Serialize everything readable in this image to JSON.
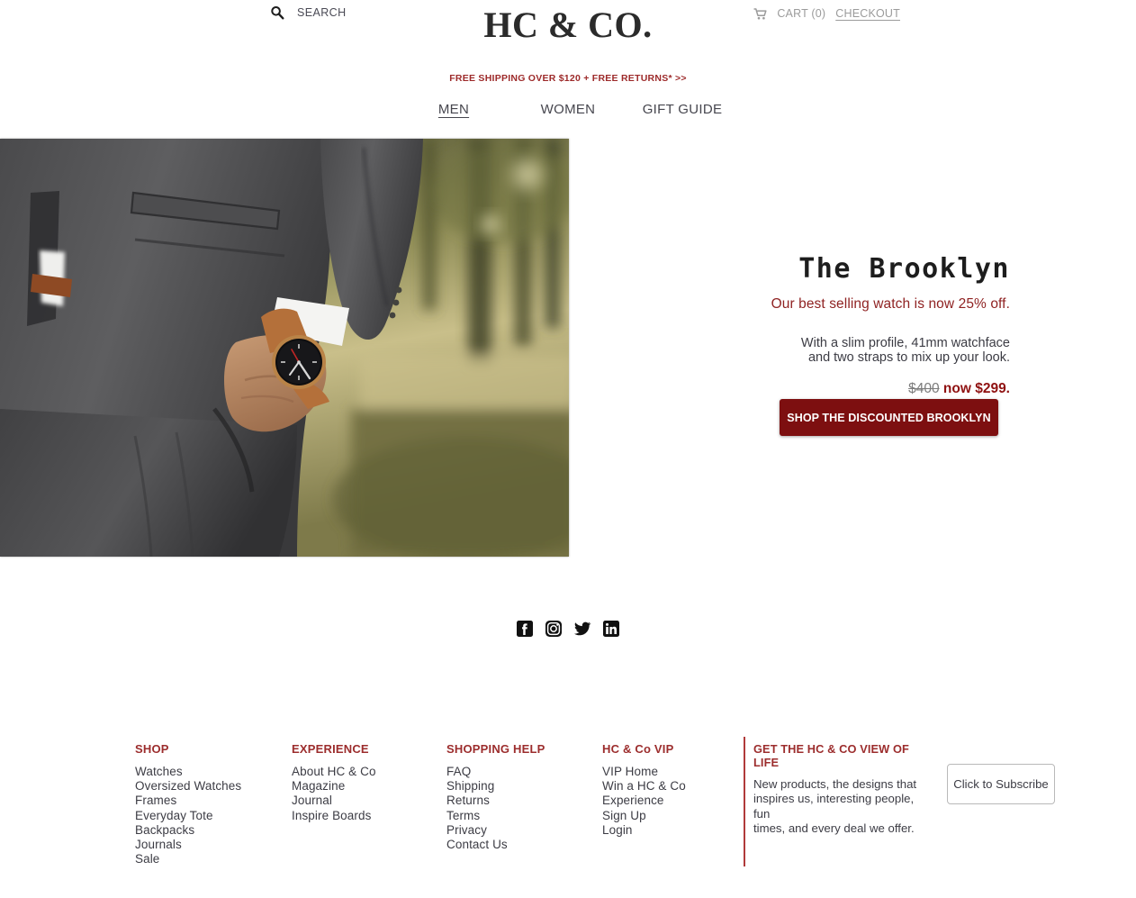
{
  "header": {
    "search_icon": "search-icon",
    "search_label": "SEARCH",
    "logo": "HC & CO.",
    "cart_icon": "shopping-cart-icon",
    "cart_label": "CART (0)",
    "checkout_label": "CHECKOUT"
  },
  "promo": {
    "text": "FREE SHIPPING OVER $120  +  FREE RETURNS* >>",
    "color": "#9d2a2a"
  },
  "nav": {
    "items": [
      {
        "label": "MEN",
        "active": true
      },
      {
        "label": "WOMEN",
        "active": false
      },
      {
        "label": "GIFT GUIDE",
        "active": false
      }
    ]
  },
  "hero": {
    "image_alt": "man-in-grey-tweed-suit-with-hand-in-pocket-wearing-watch",
    "title": "The Brooklyn",
    "tagline": "Our best selling watch is now 25% off.",
    "description_line1": "With a slim profile, 41mm watchface",
    "description_line2": "and two straps to mix up your look.",
    "price_old": "$400",
    "price_new": "now $299.",
    "cta_label": "SHOP THE DISCOUNTED BROOKLYN",
    "cta_color": "#7d0f10"
  },
  "social": {
    "items": [
      {
        "name": "facebook-icon"
      },
      {
        "name": "instagram-icon"
      },
      {
        "name": "twitter-icon"
      },
      {
        "name": "linkedin-icon"
      }
    ]
  },
  "footer": {
    "columns": [
      {
        "heading": "SHOP",
        "links": [
          "Watches",
          "Oversized Watches",
          "Frames",
          "Everyday Tote",
          "Backpacks",
          "Journals",
          "Sale"
        ]
      },
      {
        "heading": "EXPERIENCE",
        "links": [
          "About HC & Co",
          "Magazine",
          "Journal",
          "Inspire Boards"
        ]
      },
      {
        "heading": "SHOPPING HELP",
        "links": [
          "FAQ",
          "Shipping",
          "Returns",
          "Terms",
          "Privacy",
          "Contact Us"
        ]
      },
      {
        "heading": "HC & Co VIP",
        "links": [
          "VIP Home",
          "Win a HC & Co",
          "Experience",
          "Sign Up",
          "Login"
        ]
      }
    ],
    "subscribe": {
      "heading": "GET THE HC & CO VIEW OF LIFE",
      "body_line1": "New products, the designs that",
      "body_line2": "inspires us, interesting people, fun",
      "body_line3": "times, and every deal we offer.",
      "button_label": "Click to Subscribe",
      "accent_color": "#b03a3a"
    }
  }
}
